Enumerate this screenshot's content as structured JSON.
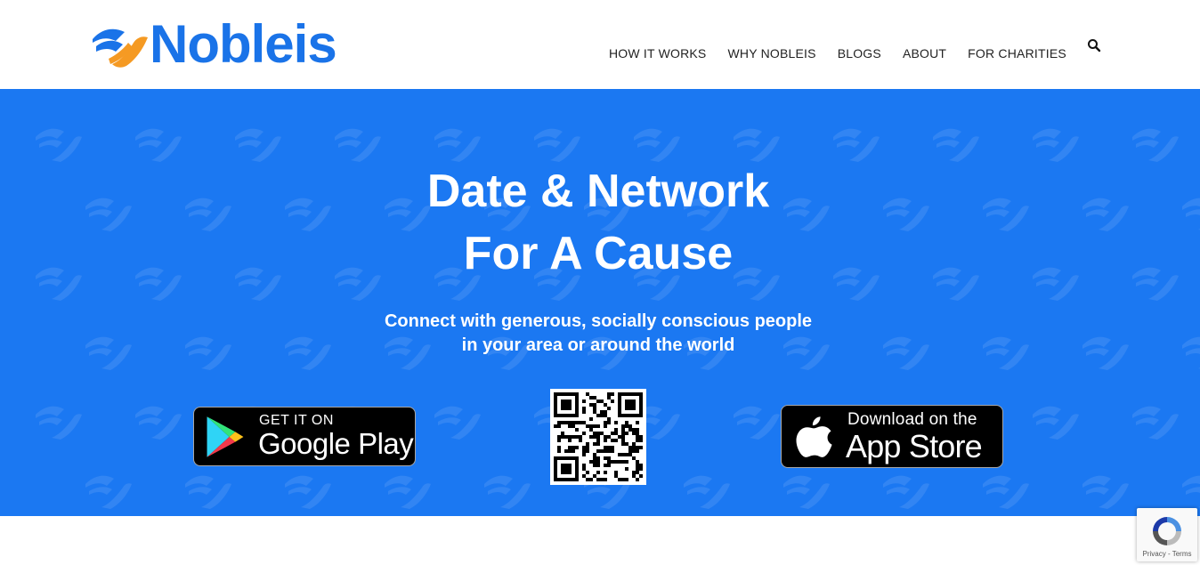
{
  "header": {
    "logo_text": "Nobleis",
    "nav": [
      "HOW IT WORKS",
      "WHY NOBLEIS",
      "BLOGS",
      "ABOUT",
      "FOR CHARITIES"
    ],
    "search_icon": "search-icon"
  },
  "hero": {
    "title_line1": "Date & Network",
    "title_line2": "For A Cause",
    "subtitle_line1": "Connect with generous, socially conscious people",
    "subtitle_line2": "in your area or around the world",
    "google_play": {
      "small": "GET IT ON",
      "big": "Google Play"
    },
    "app_store": {
      "small": "Download on the",
      "big": "App Store"
    },
    "qr_icon": "qr-code"
  },
  "recaptcha": {
    "label": "Privacy - Terms"
  },
  "colors": {
    "brand_blue": "#1b78f2",
    "logo_orange": "#f59a23",
    "nav_text": "#222222"
  }
}
